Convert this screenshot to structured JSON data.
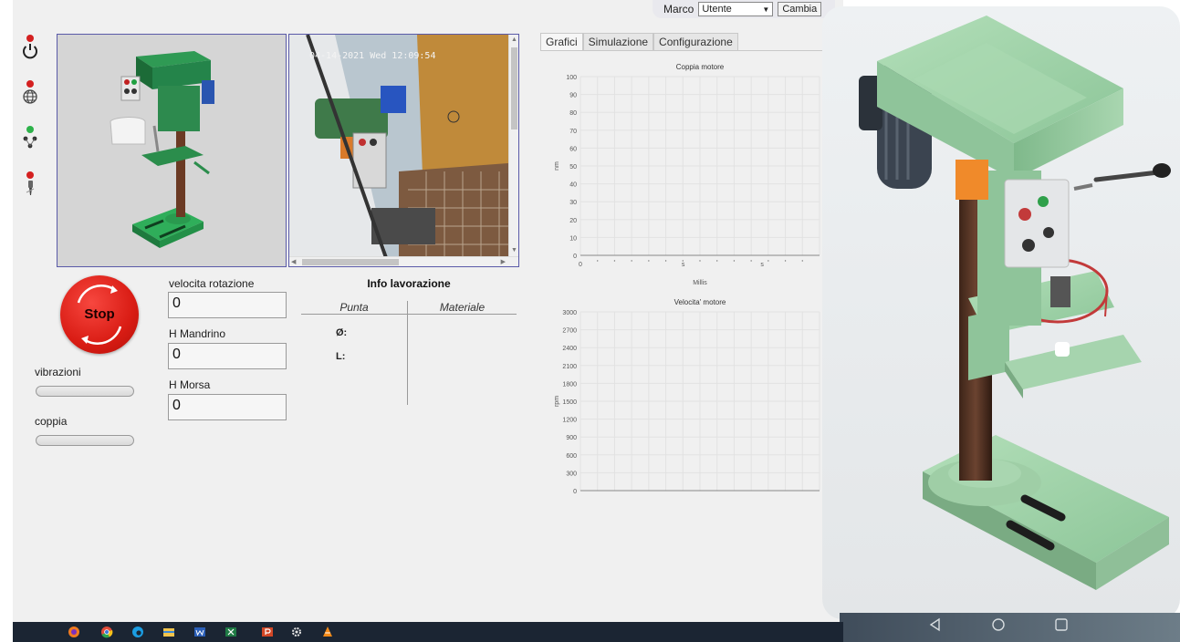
{
  "header": {
    "user_name": "Marco",
    "role_select_value": "Utente",
    "change_button": "Cambia"
  },
  "status_indicators": [
    {
      "name": "power",
      "color": "#d42020",
      "icon": "power-icon"
    },
    {
      "name": "network",
      "color": "#d42020",
      "icon": "globe-icon"
    },
    {
      "name": "connection",
      "color": "#2db24a",
      "icon": "nodes-icon"
    },
    {
      "name": "tool",
      "color": "#d42020",
      "icon": "drill-bit-icon"
    }
  ],
  "camera": {
    "timestamp": "04-14-2021 Wed 12:09:54"
  },
  "controls": {
    "stop_label": "Stop",
    "vibration_label": "vibrazioni",
    "vibration_level": 0,
    "torque_label": "coppia",
    "torque_level": 0
  },
  "fields": {
    "rotation_speed_label": "velocita rotazione",
    "rotation_speed_value": "0",
    "spindle_height_label": "H Mandrino",
    "spindle_height_value": "0",
    "vise_height_label": "H Morsa",
    "vise_height_value": "0"
  },
  "info": {
    "title": "Info lavorazione",
    "col_tip": "Punta",
    "col_material": "Materiale",
    "diameter_key": "Ø:",
    "length_key": "L:"
  },
  "tabs": {
    "charts": "Grafici",
    "simulation": "Simulazione",
    "configuration": "Configurazione",
    "active": "Grafici"
  },
  "taskbar": {
    "apps": [
      "firefox-icon",
      "chrome-icon",
      "edge-icon",
      "file-explorer-icon",
      "word-icon",
      "excel-icon",
      "powerpoint-icon",
      "settings-icon",
      "vlc-icon"
    ]
  },
  "colors": {
    "stop_red": "#d91c14",
    "panel_border": "#5a5aa8",
    "machine_green": "#3f8f5a",
    "render_green": "#8fc79a"
  },
  "chart_data": [
    {
      "type": "line",
      "title": "Coppia motore",
      "xlabel": "Millis",
      "ylabel": "nm",
      "ylim": [
        0,
        100
      ],
      "y_ticks": [
        "0",
        "10",
        "20",
        "30",
        "40",
        "50",
        "60",
        "70",
        "80",
        "90",
        "100"
      ],
      "x_ticks": [
        "0",
        "s",
        "s"
      ],
      "grid": true,
      "series": []
    },
    {
      "type": "line",
      "title": "Velocita' motore",
      "xlabel": "",
      "ylabel": "rpm",
      "ylim": [
        0,
        3000
      ],
      "y_ticks": [
        "0",
        "300",
        "600",
        "900",
        "1200",
        "1500",
        "1800",
        "2100",
        "2400",
        "2700",
        "3000"
      ],
      "grid": true,
      "series": []
    }
  ]
}
